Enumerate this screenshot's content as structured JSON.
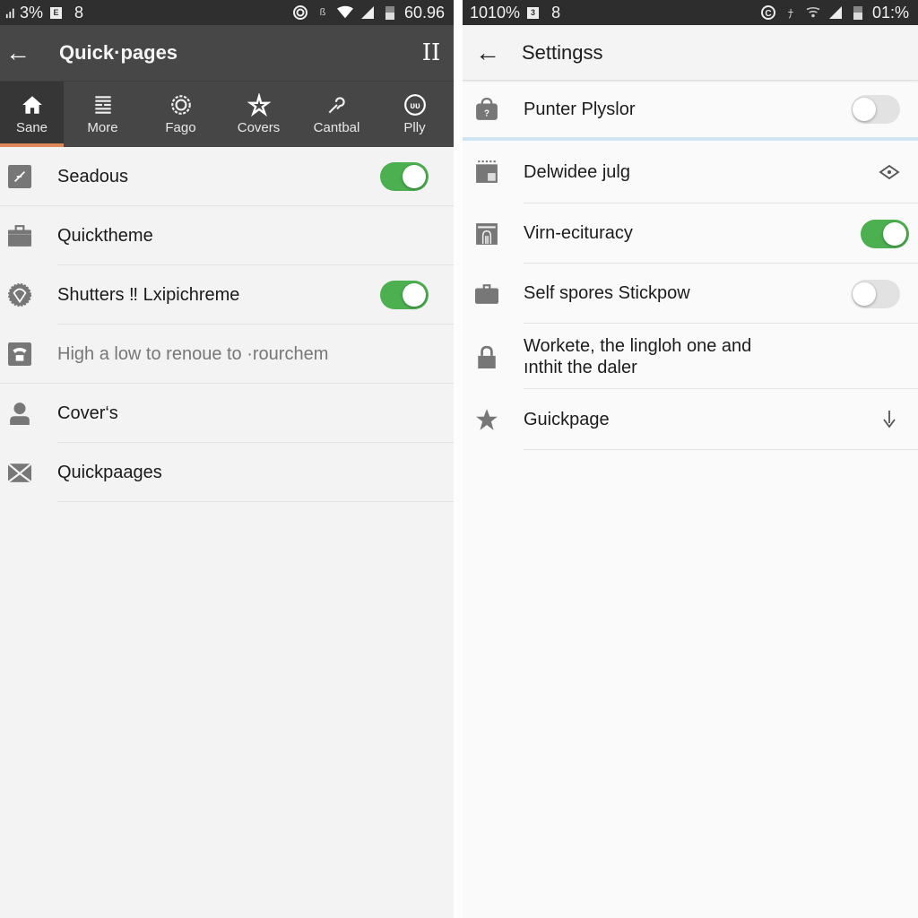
{
  "left": {
    "status": {
      "signal_text": "3%",
      "notif": "8",
      "time": "60.96"
    },
    "appbar": {
      "title": "Quick·pages",
      "menu_glyph": "II"
    },
    "tabs": [
      {
        "label": "Sane",
        "icon": "home-icon",
        "active": true
      },
      {
        "label": "More",
        "icon": "list-icon",
        "active": false
      },
      {
        "label": "Fago",
        "icon": "gear-icon",
        "active": false
      },
      {
        "label": "Covers",
        "icon": "star-icon",
        "active": false
      },
      {
        "label": "Cantbal",
        "icon": "tool-icon",
        "active": false
      },
      {
        "label": "Plly",
        "icon": "circle-logo-icon",
        "active": false
      }
    ],
    "items": [
      {
        "label": "Seadous",
        "icon": "pen-icon",
        "toggle": "on"
      },
      {
        "label": "Quicktheme",
        "icon": "briefcase-icon",
        "toggle": null
      },
      {
        "label": "Shutters ‼ Lxipichreme",
        "icon": "badge-icon",
        "toggle": "on"
      },
      {
        "label": "High a low to renoue to ·rourchem",
        "icon": "phone-icon",
        "toggle": null,
        "muted": true
      },
      {
        "label": "Cover‘s",
        "icon": "person-icon",
        "toggle": null
      },
      {
        "label": "Quickpaages",
        "icon": "mail-icon",
        "toggle": null
      }
    ]
  },
  "right": {
    "status": {
      "signal_text": "1010%",
      "notif": "8",
      "time": "01:%"
    },
    "appbar": {
      "title": "Settingss"
    },
    "items": [
      {
        "label": "Punter Plyslor",
        "icon": "bag-icon",
        "trail": "toggle-off"
      },
      {
        "label": "Delwidee julg",
        "icon": "calendar-icon",
        "trail": "eye-icon"
      },
      {
        "label": "Virn-ecituracy",
        "icon": "fingerprint-icon",
        "trail": "toggle-on"
      },
      {
        "label": "Self spores Stickpow",
        "icon": "briefcase-icon",
        "trail": "toggle-off"
      },
      {
        "label": "Workete, the lingloh one and",
        "label2": "ınthit the daler",
        "icon": "lock-icon",
        "trail": null
      },
      {
        "label": "Guickpage",
        "icon": "star-icon",
        "trail": "download-icon"
      }
    ]
  },
  "colors": {
    "accent_toggle": "#4caf50",
    "tab_indicator": "#e0875a",
    "divider_blue": "#cfe6f2"
  }
}
